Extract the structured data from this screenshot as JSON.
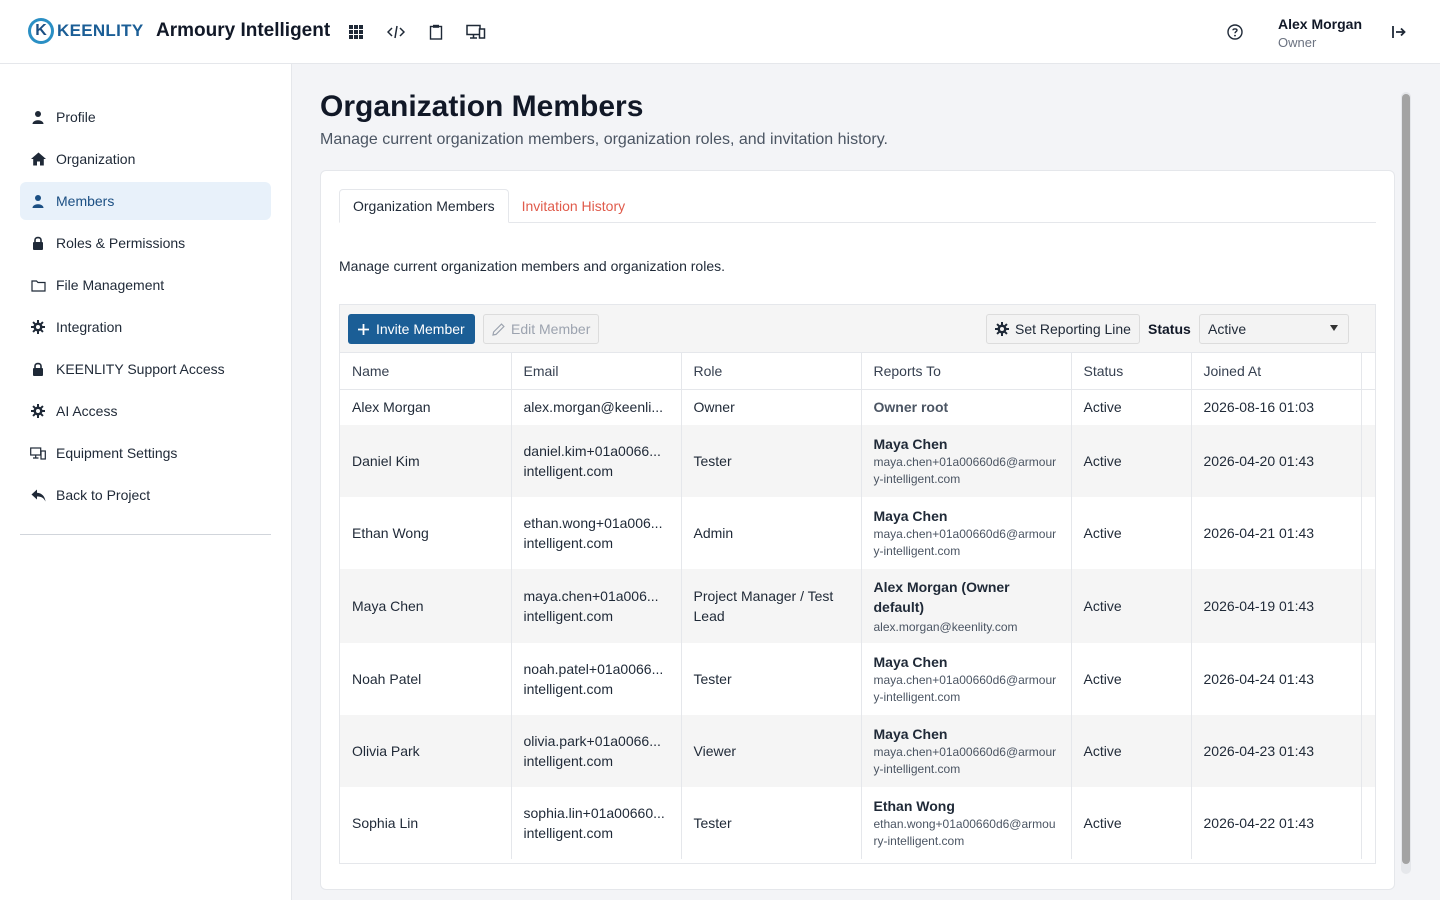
{
  "header": {
    "logo_letter": "K",
    "logo_text": "KEENLITY",
    "app_title": "Armoury Intelligent",
    "user_name": "Alex Morgan",
    "user_role": "Owner"
  },
  "sidebar": {
    "items": [
      {
        "label": "Profile",
        "icon": "person-icon"
      },
      {
        "label": "Organization",
        "icon": "home-icon"
      },
      {
        "label": "Members",
        "icon": "person-icon"
      },
      {
        "label": "Roles & Permissions",
        "icon": "lock-icon"
      },
      {
        "label": "File Management",
        "icon": "folder-icon"
      },
      {
        "label": "Integration",
        "icon": "gear-icon"
      },
      {
        "label": "KEENLITY Support Access",
        "icon": "lock-icon"
      },
      {
        "label": "AI Access",
        "icon": "gear-icon"
      },
      {
        "label": "Equipment Settings",
        "icon": "devices-icon"
      },
      {
        "label": "Back to Project",
        "icon": "reply-icon"
      }
    ],
    "active_index": 2
  },
  "main": {
    "title": "Organization Members",
    "subtitle": "Manage current organization members, organization roles, and invitation history.",
    "tabs": [
      {
        "label": "Organization Members"
      },
      {
        "label": "Invitation History"
      }
    ],
    "description": "Manage current organization members and organization roles.",
    "toolbar": {
      "invite_label": "Invite Member",
      "edit_label": "Edit Member",
      "reporting_label": "Set Reporting Line",
      "status_label": "Status",
      "status_value": "Active"
    },
    "table": {
      "columns": [
        "Name",
        "Email",
        "Role",
        "Reports To",
        "Status",
        "Joined At"
      ],
      "rows": [
        {
          "name": "Alex Morgan",
          "email1": "alex.morgan@keenli...",
          "email2": "",
          "role": "Owner",
          "reports_name": "Owner root",
          "reports_email": "",
          "status": "Active",
          "joined": "2026-08-16 01:03"
        },
        {
          "name": "Daniel Kim",
          "email1": "daniel.kim+01a0066...",
          "email2": "intelligent.com",
          "role": "Tester",
          "reports_name": "Maya Chen",
          "reports_email": "maya.chen+01a00660d6@armoury-intelligent.com",
          "status": "Active",
          "joined": "2026-04-20 01:43"
        },
        {
          "name": "Ethan Wong",
          "email1": "ethan.wong+01a006...",
          "email2": "intelligent.com",
          "role": "Admin",
          "reports_name": "Maya Chen",
          "reports_email": "maya.chen+01a00660d6@armoury-intelligent.com",
          "status": "Active",
          "joined": "2026-04-21 01:43"
        },
        {
          "name": "Maya Chen",
          "email1": "maya.chen+01a006...",
          "email2": "intelligent.com",
          "role": "Project Manager / Test Lead",
          "reports_name": "Alex Morgan (Owner default)",
          "reports_email": "alex.morgan@keenlity.com",
          "status": "Active",
          "joined": "2026-04-19 01:43"
        },
        {
          "name": "Noah Patel",
          "email1": "noah.patel+01a0066...",
          "email2": "intelligent.com",
          "role": "Tester",
          "reports_name": "Maya Chen",
          "reports_email": "maya.chen+01a00660d6@armoury-intelligent.com",
          "status": "Active",
          "joined": "2026-04-24 01:43"
        },
        {
          "name": "Olivia Park",
          "email1": "olivia.park+01a0066...",
          "email2": "intelligent.com",
          "role": "Viewer",
          "reports_name": "Maya Chen",
          "reports_email": "maya.chen+01a00660d6@armoury-intelligent.com",
          "status": "Active",
          "joined": "2026-04-23 01:43"
        },
        {
          "name": "Sophia Lin",
          "email1": "sophia.lin+01a00660...",
          "email2": "intelligent.com",
          "role": "Tester",
          "reports_name": "Ethan Wong",
          "reports_email": "ethan.wong+01a00660d6@armoury-intelligent.com",
          "status": "Active",
          "joined": "2026-04-22 01:43"
        }
      ]
    }
  },
  "colors": {
    "brand": "#1b5e96",
    "active_nav_bg": "#e8f1fa",
    "tab_link": "#e05b4b"
  }
}
